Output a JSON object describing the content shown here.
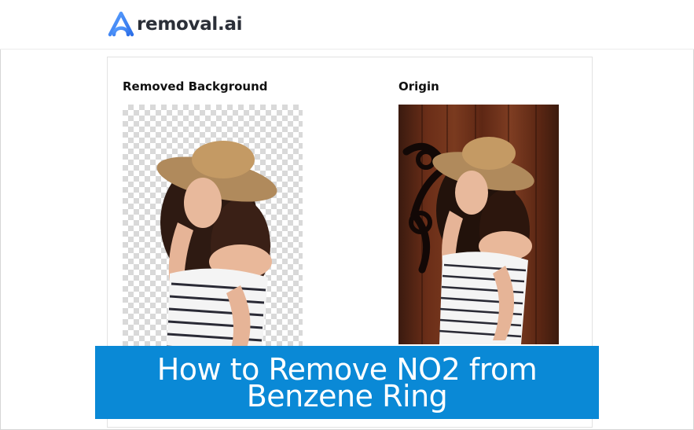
{
  "brand": {
    "name": "removal.ai",
    "logo_icon": "removal-ai-logo-icon",
    "accent_color": "#3b82f6"
  },
  "comparison": {
    "removed_title": "Removed Background",
    "origin_title": "Origin",
    "removed_image": "woman-in-straw-hat-transparent-background",
    "origin_image": "woman-in-straw-hat-wooden-door-background"
  },
  "banner": {
    "text": "How to Remove NO2 from Benzene Ring",
    "background_color": "#0a89d6"
  }
}
